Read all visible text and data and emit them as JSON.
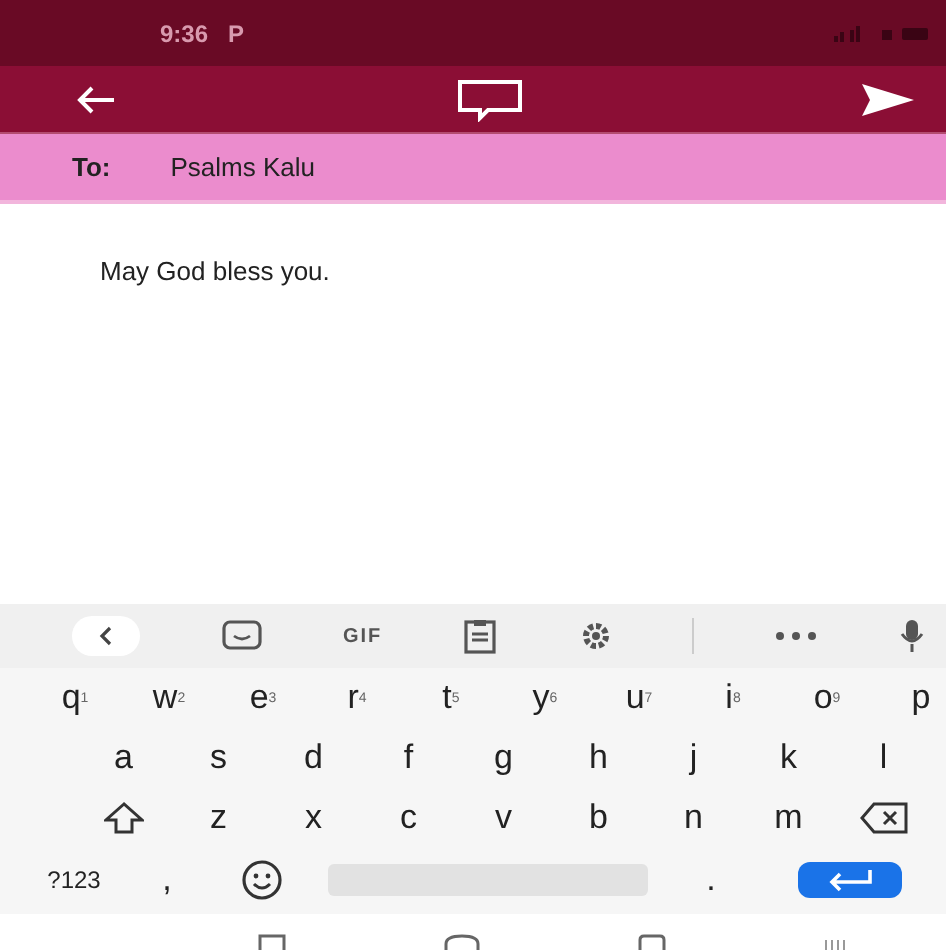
{
  "status_bar": {
    "time": "9:36",
    "notification": "P"
  },
  "recipient": {
    "label": "To:",
    "name": "Psalms Kalu"
  },
  "message": {
    "text": "May God bless you."
  },
  "keyboard": {
    "toolbar_text": "GIF",
    "rows": [
      {
        "keys": [
          {
            "label": "q",
            "hint": "1"
          },
          {
            "label": "w",
            "hint": "2"
          },
          {
            "label": "e",
            "hint": "3"
          },
          {
            "label": "r",
            "hint": "4"
          },
          {
            "label": "t",
            "hint": "5"
          },
          {
            "label": "y",
            "hint": "6"
          },
          {
            "label": "u",
            "hint": "7"
          },
          {
            "label": "i",
            "hint": "8"
          },
          {
            "label": "o",
            "hint": "9"
          },
          {
            "label": "p"
          }
        ]
      },
      {
        "keys": [
          {
            "label": "a"
          },
          {
            "label": "s"
          },
          {
            "label": "d"
          },
          {
            "label": "f"
          },
          {
            "label": "g"
          },
          {
            "label": "h"
          },
          {
            "label": "j"
          },
          {
            "label": "k"
          },
          {
            "label": "l"
          }
        ]
      },
      {
        "keys": [
          {
            "kind": "shift"
          },
          {
            "label": "z"
          },
          {
            "label": "x"
          },
          {
            "label": "c"
          },
          {
            "label": "v"
          },
          {
            "label": "b"
          },
          {
            "label": "n"
          },
          {
            "label": "m"
          },
          {
            "kind": "backspace"
          }
        ]
      }
    ],
    "bottom": {
      "symbols": "?123",
      "comma": ",",
      "period": "."
    }
  }
}
